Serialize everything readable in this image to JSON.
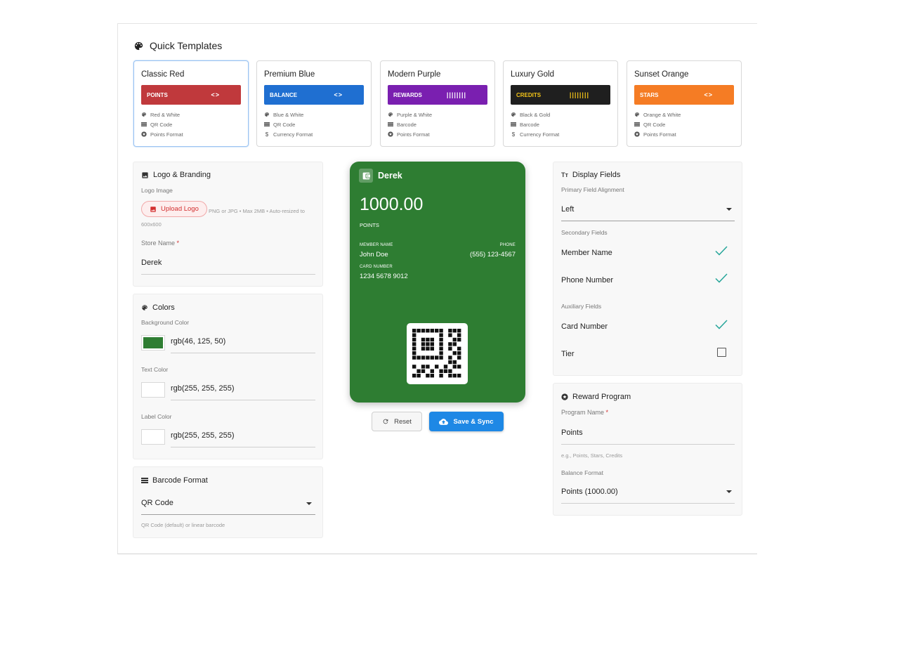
{
  "quick_templates": {
    "title": "Quick Templates",
    "items": [
      {
        "name": "Classic Red",
        "strip_label": "POINTS",
        "marker": "<>",
        "strip_color": "#c0393c",
        "strip_text_color": "#ffffff",
        "selected": true,
        "features": [
          {
            "icon": "palette-icon",
            "text": "Red & White"
          },
          {
            "icon": "qr-code-icon",
            "text": "QR Code"
          },
          {
            "icon": "stars-icon",
            "text": "Points Format"
          }
        ]
      },
      {
        "name": "Premium Blue",
        "strip_label": "BALANCE",
        "marker": "<>",
        "strip_color": "#1f6fd1",
        "strip_text_color": "#ffffff",
        "selected": false,
        "features": [
          {
            "icon": "palette-icon",
            "text": "Blue & White"
          },
          {
            "icon": "qr-code-icon",
            "text": "QR Code"
          },
          {
            "icon": "dollar-icon",
            "text": "Currency Format"
          }
        ]
      },
      {
        "name": "Modern Purple",
        "strip_label": "REWARDS",
        "marker": "||||||||",
        "strip_color": "#7a1fb0",
        "strip_text_color": "#ffffff",
        "selected": false,
        "features": [
          {
            "icon": "palette-icon",
            "text": "Purple & White"
          },
          {
            "icon": "barcode-icon",
            "text": "Barcode"
          },
          {
            "icon": "stars-icon",
            "text": "Points Format"
          }
        ]
      },
      {
        "name": "Luxury Gold",
        "strip_label": "CREDITS",
        "marker": "||||||||",
        "strip_color": "#1f1f1f",
        "strip_text_color": "#f5c518",
        "selected": false,
        "features": [
          {
            "icon": "palette-icon",
            "text": "Black & Gold"
          },
          {
            "icon": "barcode-icon",
            "text": "Barcode"
          },
          {
            "icon": "dollar-icon",
            "text": "Currency Format"
          }
        ]
      },
      {
        "name": "Sunset Orange",
        "strip_label": "STARS",
        "marker": "<>",
        "strip_color": "#f57c24",
        "strip_text_color": "#ffffff",
        "selected": false,
        "features": [
          {
            "icon": "palette-icon",
            "text": "Orange & White"
          },
          {
            "icon": "qr-code-icon",
            "text": "QR Code"
          },
          {
            "icon": "stars-icon",
            "text": "Points Format"
          }
        ]
      }
    ]
  },
  "logo_branding": {
    "title": "Logo & Branding",
    "logo_label": "Logo Image",
    "upload_label": "Upload Logo",
    "upload_help_1": "PNG or JPG • Max 2MB • Auto-resized to",
    "upload_help_2": "600x600",
    "store_label": "Store Name",
    "store_required": "*",
    "store_value": "Derek"
  },
  "colors": {
    "title": "Colors",
    "background_label": "Background Color",
    "background_value": "rgb(46, 125, 50)",
    "background_hex": "#2e7d32",
    "text_label": "Text Color",
    "text_value": "rgb(255, 255, 255)",
    "text_hex": "#ffffff",
    "label_label": "Label Color",
    "label_value": "rgb(255, 255, 255)",
    "label_hex": "#ffffff"
  },
  "barcode_format": {
    "title": "Barcode Format",
    "value": "QR Code",
    "help": "QR Code (default) or linear barcode"
  },
  "card_preview": {
    "store_name": "Derek",
    "balance": "1000.00",
    "unit": "POINTS",
    "member_label": "MEMBER NAME",
    "member_value": "John Doe",
    "phone_label": "PHONE",
    "phone_value": "(555) 123-4567",
    "card_label": "CARD NUMBER",
    "card_value": "1234 5678 9012",
    "background": "#2e7d32",
    "text_color": "#ffffff"
  },
  "actions": {
    "reset_label": "Reset",
    "save_label": "Save & Sync"
  },
  "display_fields": {
    "title": "Display Fields",
    "alignment_label": "Primary Field Alignment",
    "alignment_value": "Left",
    "secondary_label": "Secondary Fields",
    "secondary": [
      {
        "label": "Member Name",
        "checked": true
      },
      {
        "label": "Phone Number",
        "checked": true
      }
    ],
    "auxiliary_label": "Auxiliary Fields",
    "auxiliary": [
      {
        "label": "Card Number",
        "checked": true
      },
      {
        "label": "Tier",
        "checked": false
      }
    ]
  },
  "reward_program": {
    "title": "Reward Program",
    "program_label": "Program Name",
    "program_required": "*",
    "program_value": "Points",
    "program_help": "e.g., Points, Stars, Credits",
    "format_label": "Balance Format",
    "format_value": "Points (1000.00)"
  },
  "theme": {
    "accent": "#1e88e5",
    "check_color": "#26a69a",
    "required_color": "#d32f2f"
  }
}
